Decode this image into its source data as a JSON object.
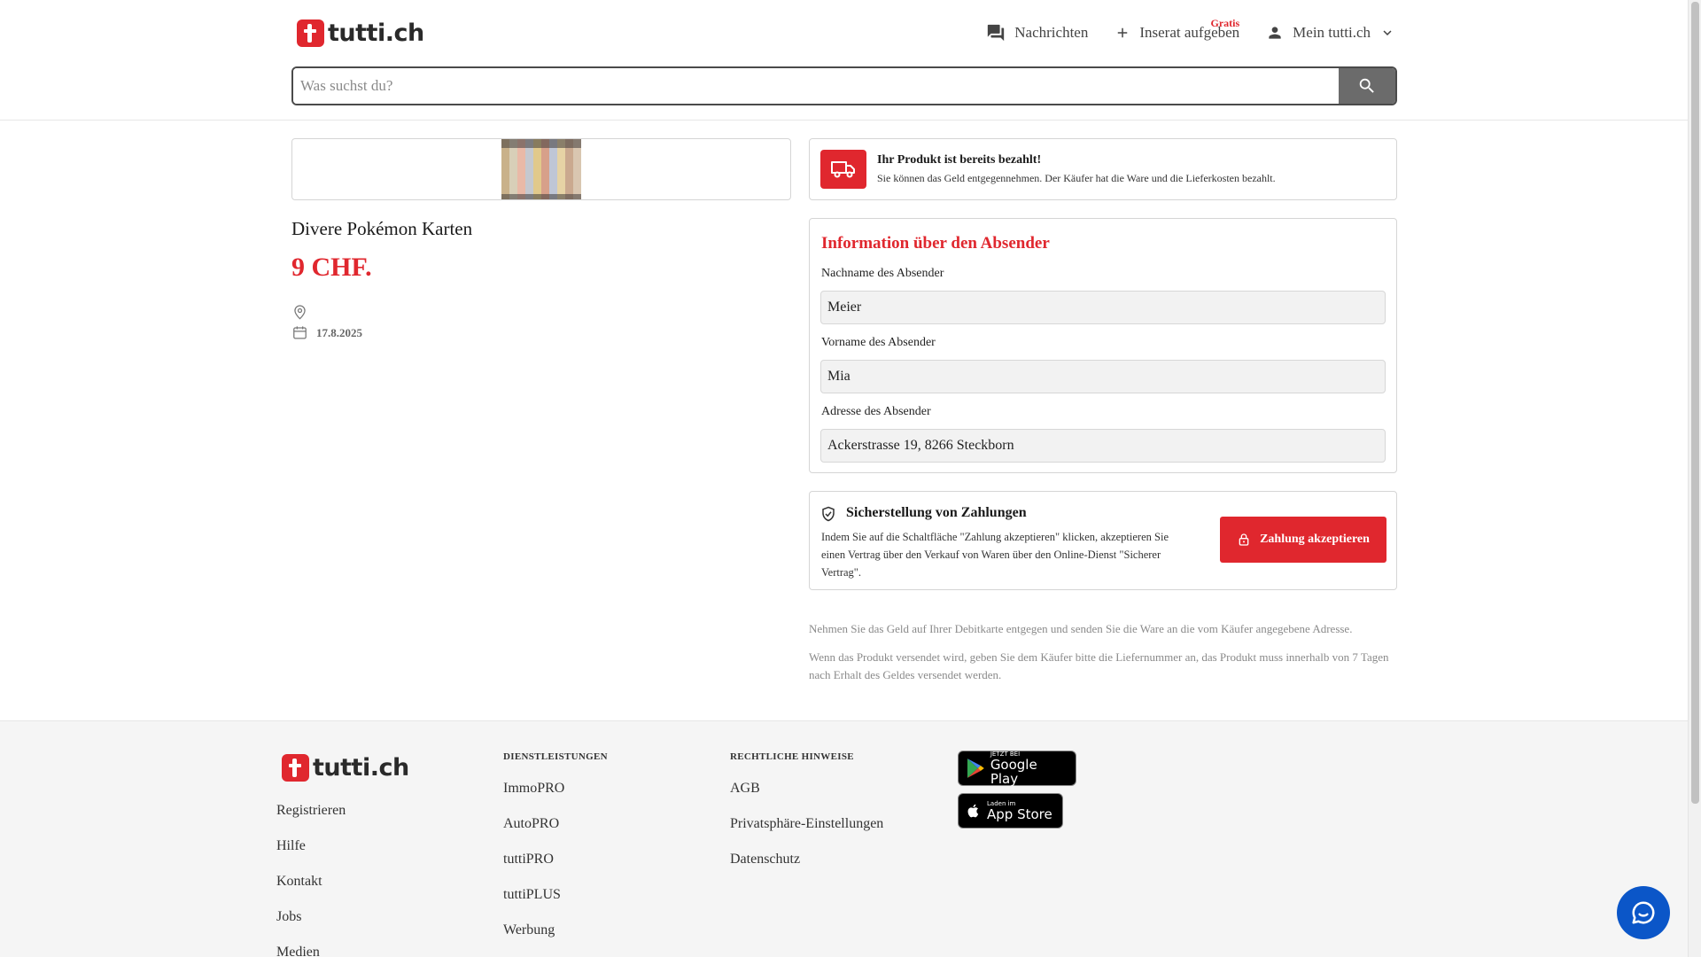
{
  "brand": {
    "name": "tutti.ch",
    "accent": "#e0272e"
  },
  "header": {
    "nav": {
      "messages": "Nachrichten",
      "post_ad": "Inserat aufgeben",
      "post_ad_badge": "Gratis",
      "account": "Mein tutti.ch"
    },
    "search": {
      "placeholder": "Was suchst du?"
    }
  },
  "product": {
    "title": "Divere Pokémon Karten",
    "price": "9 CHF.",
    "location": "",
    "date": "17.8.2025"
  },
  "paid_notice": {
    "heading": "Ihr Produkt ist bereits bezahlt!",
    "text": "Sie können das Geld entgegennehmen. Der Käufer hat die Ware und die Lieferkosten bezahlt."
  },
  "sender": {
    "heading": "Information über den Absender",
    "last_name_label": "Nachname des Absender",
    "last_name": "Meier",
    "first_name_label": "Vorname des Absender",
    "first_name": "Mia",
    "address_label": "Adresse des Absender",
    "address": "Ackerstrasse 19, 8266 Steckborn"
  },
  "payment": {
    "heading": "Sicherstellung von Zahlungen",
    "text": "Indem Sie auf die Schaltfläche \"Zahlung akzeptieren\" klicken, akzeptieren Sie einen Vertrag über den Verkauf von Waren über den Online-Dienst \"Sicherer Vertrag\".",
    "button": "Zahlung akzeptieren"
  },
  "notes": [
    "Nehmen Sie das Geld auf Ihrer Debitkarte entgegen und senden Sie die Ware an die vom Käufer angegebene Adresse.",
    "Wenn das Produkt versendet wird, geben Sie dem Käufer bitte die Liefernummer an, das Produkt muss innerhalb von 7 Tagen nach Erhalt des Geldes versendet werden."
  ],
  "footer": {
    "col1": [
      "Registrieren",
      "Hilfe",
      "Kontakt",
      "Jobs",
      "Medien"
    ],
    "services_heading": "DIENSTLEISTUNGEN",
    "services": [
      "ImmoPRO",
      "AutoPRO",
      "tuttiPRO",
      "tuttiPLUS",
      "Werbung"
    ],
    "legal_heading": "RECHTLICHE HINWEISE",
    "legal": [
      "AGB",
      "Privatsphäre-Einstellungen",
      "Datenschutz"
    ],
    "google_play": {
      "small": "JETZT BEI",
      "big": "Google Play"
    },
    "app_store": {
      "small": "Laden im",
      "big": "App Store"
    }
  }
}
